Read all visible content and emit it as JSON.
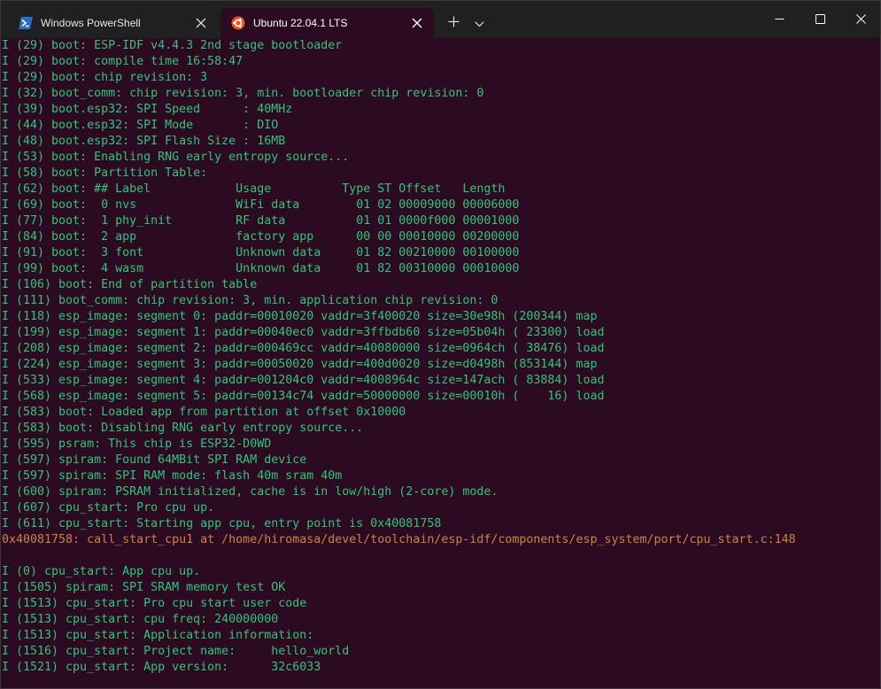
{
  "tabs": [
    {
      "title": "Windows PowerShell",
      "icon": "powershell-icon",
      "active": false
    },
    {
      "title": "Ubuntu 22.04.1 LTS",
      "icon": "ubuntu-icon",
      "active": true
    }
  ],
  "colors": {
    "terminal_bg": "#2c0a22",
    "info_text": "#33c47a",
    "warn_text": "#c98540",
    "tabbar_bg": "#202020"
  },
  "terminal": {
    "lines": [
      {
        "text": "I (29) boot: ESP-IDF v4.4.3 2nd stage bootloader",
        "kind": "info"
      },
      {
        "text": "I (29) boot: compile time 16:58:47",
        "kind": "info"
      },
      {
        "text": "I (29) boot: chip revision: 3",
        "kind": "info"
      },
      {
        "text": "I (32) boot_comm: chip revision: 3, min. bootloader chip revision: 0",
        "kind": "info"
      },
      {
        "text": "I (39) boot.esp32: SPI Speed      : 40MHz",
        "kind": "info"
      },
      {
        "text": "I (44) boot.esp32: SPI Mode       : DIO",
        "kind": "info"
      },
      {
        "text": "I (48) boot.esp32: SPI Flash Size : 16MB",
        "kind": "info"
      },
      {
        "text": "I (53) boot: Enabling RNG early entropy source...",
        "kind": "info"
      },
      {
        "text": "I (58) boot: Partition Table:",
        "kind": "info"
      },
      {
        "text": "I (62) boot: ## Label            Usage          Type ST Offset   Length",
        "kind": "info"
      },
      {
        "text": "I (69) boot:  0 nvs              WiFi data        01 02 00009000 00006000",
        "kind": "info"
      },
      {
        "text": "I (77) boot:  1 phy_init         RF data          01 01 0000f000 00001000",
        "kind": "info"
      },
      {
        "text": "I (84) boot:  2 app              factory app      00 00 00010000 00200000",
        "kind": "info"
      },
      {
        "text": "I (91) boot:  3 font             Unknown data     01 82 00210000 00100000",
        "kind": "info"
      },
      {
        "text": "I (99) boot:  4 wasm             Unknown data     01 82 00310000 00010000",
        "kind": "info"
      },
      {
        "text": "I (106) boot: End of partition table",
        "kind": "info"
      },
      {
        "text": "I (111) boot_comm: chip revision: 3, min. application chip revision: 0",
        "kind": "info"
      },
      {
        "text": "I (118) esp_image: segment 0: paddr=00010020 vaddr=3f400020 size=30e98h (200344) map",
        "kind": "info"
      },
      {
        "text": "I (199) esp_image: segment 1: paddr=00040ec0 vaddr=3ffbdb60 size=05b04h ( 23300) load",
        "kind": "info"
      },
      {
        "text": "I (208) esp_image: segment 2: paddr=000469cc vaddr=40080000 size=0964ch ( 38476) load",
        "kind": "info"
      },
      {
        "text": "I (224) esp_image: segment 3: paddr=00050020 vaddr=400d0020 size=d0498h (853144) map",
        "kind": "info"
      },
      {
        "text": "I (533) esp_image: segment 4: paddr=001204c0 vaddr=4008964c size=147ach ( 83884) load",
        "kind": "info"
      },
      {
        "text": "I (568) esp_image: segment 5: paddr=00134c74 vaddr=50000000 size=00010h (    16) load",
        "kind": "info"
      },
      {
        "text": "I (583) boot: Loaded app from partition at offset 0x10000",
        "kind": "info"
      },
      {
        "text": "I (583) boot: Disabling RNG early entropy source...",
        "kind": "info"
      },
      {
        "text": "I (595) psram: This chip is ESP32-D0WD",
        "kind": "info"
      },
      {
        "text": "I (597) spiram: Found 64MBit SPI RAM device",
        "kind": "info"
      },
      {
        "text": "I (597) spiram: SPI RAM mode: flash 40m sram 40m",
        "kind": "info"
      },
      {
        "text": "I (600) spiram: PSRAM initialized, cache is in low/high (2-core) mode.",
        "kind": "info"
      },
      {
        "text": "I (607) cpu_start: Pro cpu up.",
        "kind": "info"
      },
      {
        "text": "I (611) cpu_start: Starting app cpu, entry point is 0x40081758",
        "kind": "info"
      },
      {
        "text": "0x40081758: call_start_cpu1 at /home/hiromasa/devel/toolchain/esp-idf/components/esp_system/port/cpu_start.c:148",
        "kind": "warn"
      },
      {
        "text": "",
        "kind": "info"
      },
      {
        "text": "I (0) cpu_start: App cpu up.",
        "kind": "info"
      },
      {
        "text": "I (1505) spiram: SPI SRAM memory test OK",
        "kind": "info"
      },
      {
        "text": "I (1513) cpu_start: Pro cpu start user code",
        "kind": "info"
      },
      {
        "text": "I (1513) cpu_start: cpu freq: 240000000",
        "kind": "info"
      },
      {
        "text": "I (1513) cpu_start: Application information:",
        "kind": "info"
      },
      {
        "text": "I (1516) cpu_start: Project name:     hello_world",
        "kind": "info"
      },
      {
        "text": "I (1521) cpu_start: App version:      32c6033",
        "kind": "info"
      }
    ]
  }
}
